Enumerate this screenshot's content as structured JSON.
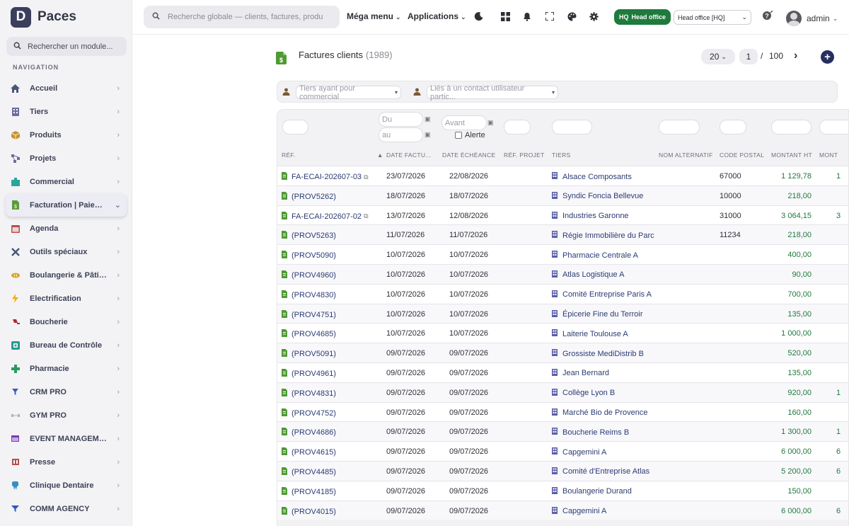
{
  "brand": {
    "logo_letter": "D",
    "name": "Paces"
  },
  "sidebar": {
    "search_placeholder": "Rechercher un module...",
    "nav_title": "NAVIGATION",
    "items": [
      {
        "label": "Accueil",
        "icon": "home-icon",
        "color": "#4a5578"
      },
      {
        "label": "Tiers",
        "icon": "building-icon",
        "color": "#6b6fa0"
      },
      {
        "label": "Produits",
        "icon": "box-icon",
        "color": "#c9932a"
      },
      {
        "label": "Projets",
        "icon": "diagram-icon",
        "color": "#6b6fa0"
      },
      {
        "label": "Commercial",
        "icon": "shop-icon",
        "color": "#2aa59b"
      },
      {
        "label": "Facturation | Paiement",
        "icon": "invoice-icon",
        "color": "#5c9a3a",
        "active": true
      },
      {
        "label": "Agenda",
        "icon": "calendar-icon",
        "color": "#b05050"
      },
      {
        "label": "Outils spéciaux",
        "icon": "tools-icon",
        "color": "#4a5578"
      },
      {
        "label": "Boulangerie & Pâtisserie",
        "icon": "bread-icon",
        "color": "#d9a520"
      },
      {
        "label": "Electrification",
        "icon": "bolt-icon",
        "color": "#f2b010"
      },
      {
        "label": "Boucherie",
        "icon": "meat-icon",
        "color": "#b02a2a"
      },
      {
        "label": "Bureau de Contrôle",
        "icon": "check-icon",
        "color": "#2a9a8f"
      },
      {
        "label": "Pharmacie",
        "icon": "cross-icon",
        "color": "#2a9a5f"
      },
      {
        "label": "CRM PRO",
        "icon": "funnel-icon",
        "color": "#3a5bbf"
      },
      {
        "label": "GYM PRO",
        "icon": "dumbbell-icon",
        "color": "#b0b0b8"
      },
      {
        "label": "EVENT MANAGEMENT",
        "icon": "event-icon",
        "color": "#7a3ab0"
      },
      {
        "label": "Presse",
        "icon": "news-icon",
        "color": "#b05050"
      },
      {
        "label": "Clinique Dentaire",
        "icon": "tooth-icon",
        "color": "#3a8fbf"
      },
      {
        "label": "COMM AGENCY",
        "icon": "megaphone-icon",
        "color": "#2a5bbf"
      }
    ]
  },
  "topbar": {
    "search_placeholder": "Recherche globale — clients, factures, produits...",
    "mega_menu": "Méga menu",
    "applications": "Applications",
    "icons": [
      "moon-icon",
      "grid-icon",
      "bell-icon",
      "fullscreen-icon",
      "palette-icon",
      "gear-icon"
    ],
    "hq_badge_tag": "HQ",
    "hq_badge_label": "Head office",
    "entity_select": "Head office [HQ]",
    "user_name": "admin"
  },
  "page": {
    "title": "Factures clients",
    "count": "(1989)",
    "page_size": "20",
    "current_page": "1",
    "page_sep": "/",
    "total_pages": "100"
  },
  "filters": {
    "commercial_placeholder": "Tiers ayant pour commercial",
    "contact_placeholder": "Liés à un contact utilisateur partic..."
  },
  "table": {
    "filter_du": "Du",
    "filter_au": "au",
    "filter_avant": "Avant",
    "alert_label": "Alerte",
    "headers": [
      "RÉF.",
      "DATE FACTU...",
      "DATE ÉCHÉANCE",
      "RÉF. PROJET",
      "TIERS",
      "NOM ALTERNATIF",
      "CODE POSTAL",
      "MONTANT HT",
      "MONT"
    ],
    "rows": [
      {
        "ref": "FA-ECAI-202607-03",
        "note": true,
        "date": "23/07/2026",
        "due": "22/08/2026",
        "tiers": "Alsace Composants",
        "cp": "67000",
        "ht": "1 129,78",
        "cut": "1"
      },
      {
        "ref": "(PROV5262)",
        "note": false,
        "date": "18/07/2026",
        "due": "18/07/2026",
        "tiers": "Syndic Foncia Bellevue",
        "cp": "10000",
        "ht": "218,00",
        "cut": ""
      },
      {
        "ref": "FA-ECAI-202607-02",
        "note": true,
        "date": "13/07/2026",
        "due": "12/08/2026",
        "tiers": "Industries Garonne",
        "cp": "31000",
        "ht": "3 064,15",
        "cut": "3"
      },
      {
        "ref": "(PROV5263)",
        "note": false,
        "date": "11/07/2026",
        "due": "11/07/2026",
        "tiers": "Régie Immobilière du Parc",
        "cp": "11234",
        "ht": "218,00",
        "cut": ""
      },
      {
        "ref": "(PROV5090)",
        "note": false,
        "date": "10/07/2026",
        "due": "10/07/2026",
        "tiers": "Pharmacie Centrale A",
        "cp": "",
        "ht": "400,00",
        "cut": ""
      },
      {
        "ref": "(PROV4960)",
        "note": false,
        "date": "10/07/2026",
        "due": "10/07/2026",
        "tiers": "Atlas Logistique A",
        "cp": "",
        "ht": "90,00",
        "cut": ""
      },
      {
        "ref": "(PROV4830)",
        "note": false,
        "date": "10/07/2026",
        "due": "10/07/2026",
        "tiers": "Comité Entreprise Paris A",
        "cp": "",
        "ht": "700,00",
        "cut": ""
      },
      {
        "ref": "(PROV4751)",
        "note": false,
        "date": "10/07/2026",
        "due": "10/07/2026",
        "tiers": "Épicerie Fine du Terroir",
        "cp": "",
        "ht": "135,00",
        "cut": ""
      },
      {
        "ref": "(PROV4685)",
        "note": false,
        "date": "10/07/2026",
        "due": "10/07/2026",
        "tiers": "Laiterie Toulouse A",
        "cp": "",
        "ht": "1 000,00",
        "cut": ""
      },
      {
        "ref": "(PROV5091)",
        "note": false,
        "date": "09/07/2026",
        "due": "09/07/2026",
        "tiers": "Grossiste MediDistrib B",
        "cp": "",
        "ht": "520,00",
        "cut": ""
      },
      {
        "ref": "(PROV4961)",
        "note": false,
        "date": "09/07/2026",
        "due": "09/07/2026",
        "tiers": "Jean Bernard",
        "cp": "",
        "ht": "135,00",
        "cut": ""
      },
      {
        "ref": "(PROV4831)",
        "note": false,
        "date": "09/07/2026",
        "due": "09/07/2026",
        "tiers": "Collège Lyon B",
        "cp": "",
        "ht": "920,00",
        "cut": "1"
      },
      {
        "ref": "(PROV4752)",
        "note": false,
        "date": "09/07/2026",
        "due": "09/07/2026",
        "tiers": "Marché Bio de Provence",
        "cp": "",
        "ht": "160,00",
        "cut": ""
      },
      {
        "ref": "(PROV4686)",
        "note": false,
        "date": "09/07/2026",
        "due": "09/07/2026",
        "tiers": "Boucherie Reims B",
        "cp": "",
        "ht": "1 300,00",
        "cut": "1"
      },
      {
        "ref": "(PROV4615)",
        "note": false,
        "date": "09/07/2026",
        "due": "09/07/2026",
        "tiers": "Capgemini A",
        "cp": "",
        "ht": "6 000,00",
        "cut": "6"
      },
      {
        "ref": "(PROV4485)",
        "note": false,
        "date": "09/07/2026",
        "due": "09/07/2026",
        "tiers": "Comité d'Entreprise Atlas",
        "cp": "",
        "ht": "5 200,00",
        "cut": "6"
      },
      {
        "ref": "(PROV4185)",
        "note": false,
        "date": "09/07/2026",
        "due": "09/07/2026",
        "tiers": "Boulangerie Durand",
        "cp": "",
        "ht": "150,00",
        "cut": ""
      },
      {
        "ref": "(PROV4015)",
        "note": false,
        "date": "09/07/2026",
        "due": "09/07/2026",
        "tiers": "Capgemini A",
        "cp": "",
        "ht": "6 000,00",
        "cut": "6"
      }
    ]
  }
}
